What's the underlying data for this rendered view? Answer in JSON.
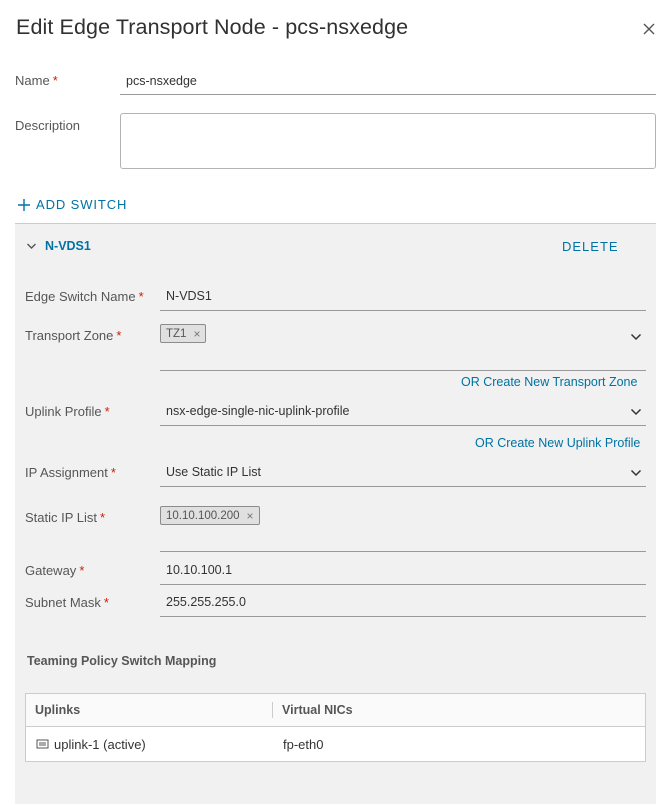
{
  "dialog": {
    "title": "Edit Edge Transport Node - pcs-nsxedge",
    "close_icon": "close-icon"
  },
  "form": {
    "name_label": "Name",
    "name_value": "pcs-nsxedge",
    "description_label": "Description",
    "description_value": "",
    "required_marker": "*"
  },
  "add_switch_label": "ADD SWITCH",
  "switch": {
    "name": "N-VDS1",
    "delete_label": "DELETE",
    "edge_switch_name_label": "Edge Switch Name",
    "edge_switch_name_value": "N-VDS1",
    "transport_zone_label": "Transport Zone",
    "transport_zone_tags": [
      "TZ1"
    ],
    "create_transport_zone_link": "OR Create New Transport Zone",
    "uplink_profile_label": "Uplink Profile",
    "uplink_profile_value": "nsx-edge-single-nic-uplink-profile",
    "create_uplink_profile_link": "OR Create New Uplink Profile",
    "ip_assignment_label": "IP Assignment",
    "ip_assignment_value": "Use Static IP List",
    "static_ip_list_label": "Static IP List",
    "static_ip_tags": [
      "10.10.100.200"
    ],
    "gateway_label": "Gateway",
    "gateway_value": "10.10.100.1",
    "subnet_mask_label": "Subnet Mask",
    "subnet_mask_value": "255.255.255.0"
  },
  "teaming": {
    "title": "Teaming Policy Switch Mapping",
    "columns": [
      "Uplinks",
      "Virtual NICs"
    ],
    "rows": [
      {
        "uplink": "uplink-1 (active)",
        "vnic": "fp-eth0",
        "icon": "uplink-icon"
      }
    ]
  },
  "colors": {
    "accent": "#0072a3",
    "required": "#c92100",
    "panel_bg": "#f1f1f1"
  }
}
